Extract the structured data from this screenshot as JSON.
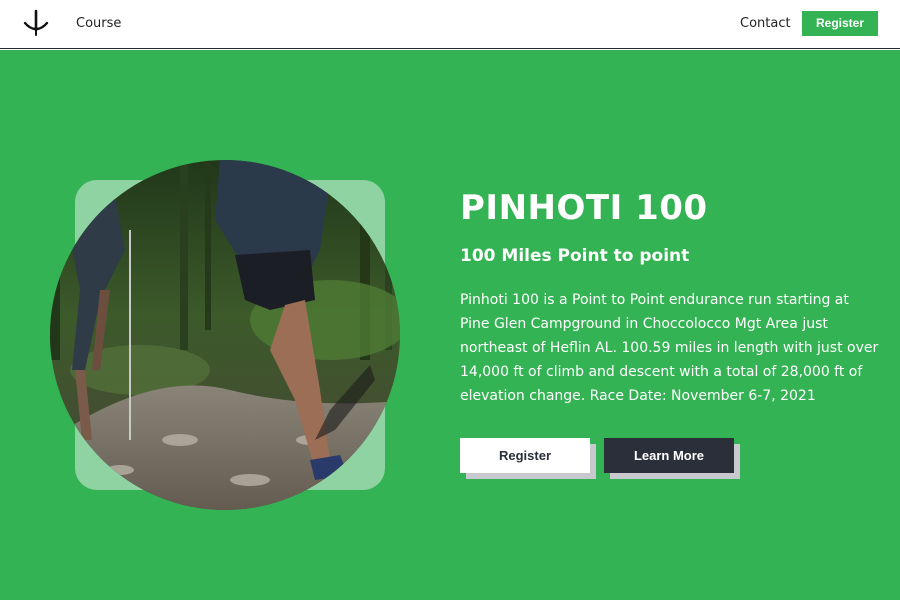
{
  "nav": {
    "logo_icon": "trident-icon",
    "course_label": "Course",
    "contact_label": "Contact",
    "register_label": "Register"
  },
  "hero": {
    "title": "PINHOTI 100",
    "subtitle": "100 Miles Point to point",
    "description": "Pinhoti 100 is a Point to Point endurance run starting at Pine Glen Campground in Choccolocco Mgt Area just northeast of Heflin AL.  100.59 miles in length with just over 14,000 ft of climb and descent with a total of 28,000 ft of elevation change. Race Date: November 6-7, 2021",
    "register_label": "Register",
    "learn_more_label": "Learn More"
  },
  "colors": {
    "brand_green": "#34b354",
    "dark_button": "#2a2f3a",
    "white": "#ffffff"
  }
}
